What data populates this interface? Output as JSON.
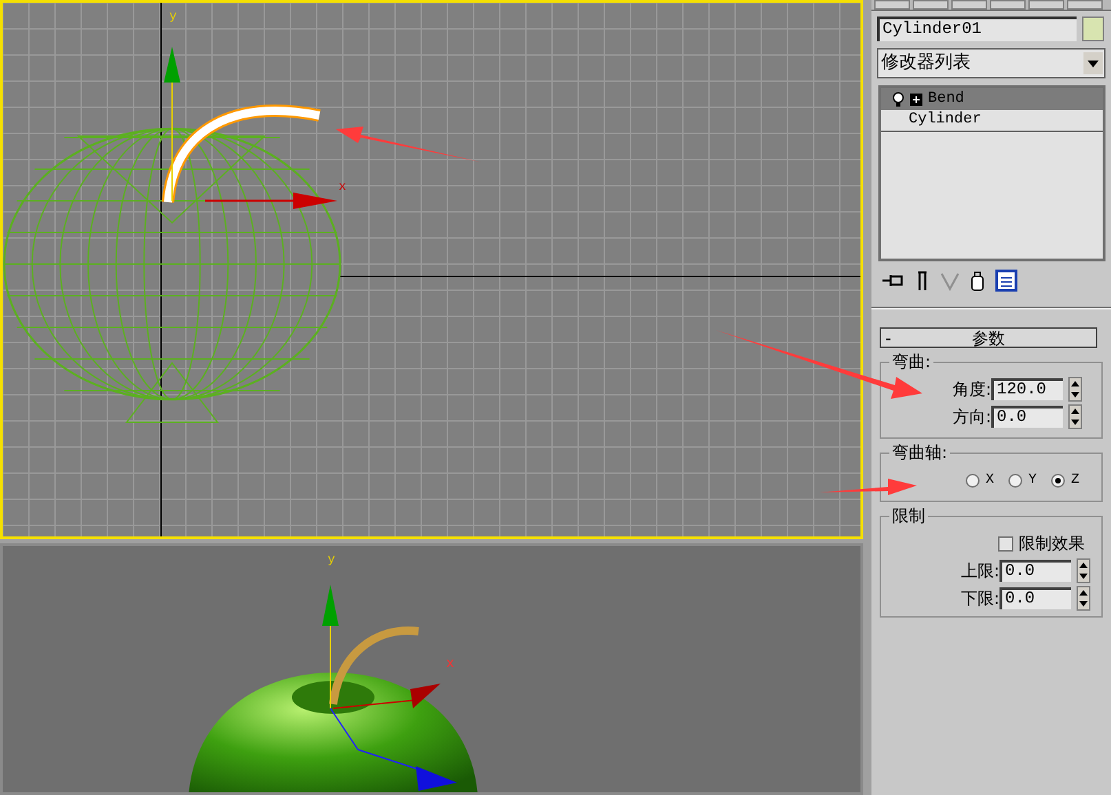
{
  "object_name": {
    "value": "Cylinder01"
  },
  "modifier_list": {
    "value": "修改器列表"
  },
  "modifier_stack": [
    {
      "label": "Bend",
      "kind": "modifier",
      "selected": true
    },
    {
      "label": "Cylinder",
      "kind": "base",
      "selected": false
    }
  ],
  "parameters": {
    "collapse": "-",
    "title": "参数",
    "bend": {
      "title": "弯曲:",
      "fields": [
        {
          "label": "角度:",
          "value": "120.0"
        },
        {
          "label": "方向:",
          "value": "0.0"
        }
      ]
    },
    "bend_axis": {
      "title": "弯曲轴:",
      "options": [
        {
          "label": "X",
          "selected": false
        },
        {
          "label": "Y",
          "selected": false
        },
        {
          "label": "Z",
          "selected": true
        }
      ]
    },
    "limits": {
      "title": "限制",
      "limit_effect": {
        "label": "限制效果",
        "checked": false
      },
      "fields": [
        {
          "label": "上限:",
          "value": "0.0"
        },
        {
          "label": "下限:",
          "value": "0.0"
        }
      ]
    }
  },
  "viewports": [
    {
      "kind": "wireframe",
      "active": true,
      "axis_labels": [
        "y",
        "x"
      ]
    },
    {
      "kind": "shaded",
      "active": false,
      "axis_labels": [
        "y",
        "x"
      ]
    }
  ]
}
